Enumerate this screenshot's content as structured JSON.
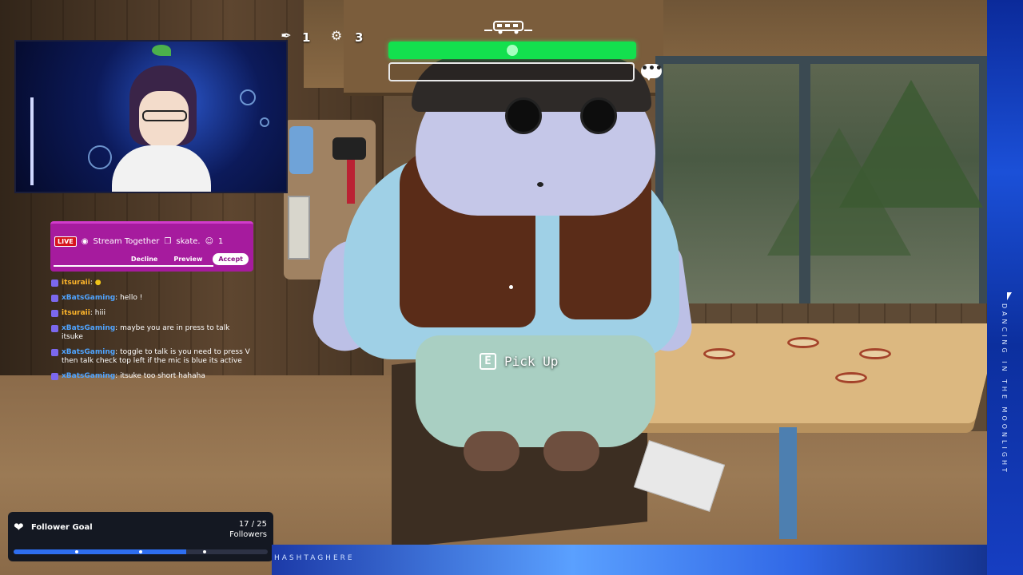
{
  "hud": {
    "item_count": "1",
    "tool_count": "3",
    "prompt_key": "E",
    "prompt_action": "Pick Up",
    "health_color": "#13e04e"
  },
  "webcam": {
    "description_icon": "vtuber-avatar"
  },
  "raid": {
    "live_label": "LIVE",
    "title": "Stream Together",
    "channel": "skate.",
    "viewers": "1",
    "decline_label": "Decline",
    "preview_label": "Preview",
    "accept_label": "Accept",
    "color": "#a61b9e"
  },
  "chat": [
    {
      "user": "itsuraii",
      "message": "",
      "emote": "duck-emote",
      "user_color": "#ffb62b"
    },
    {
      "user": "xBatsGaming",
      "message": "hello !",
      "user_color": "#4fa4ff"
    },
    {
      "user": "itsuraii",
      "message": "hiii",
      "user_color": "#ffb62b"
    },
    {
      "user": "xBatsGaming",
      "message": "maybe you are in press to talk itsuke",
      "user_color": "#4fa4ff"
    },
    {
      "user": "xBatsGaming",
      "message": "toggle to talk is you need to press V then talk check top left if the mic is blue its active",
      "user_color": "#4fa4ff"
    },
    {
      "user": "xBatsGaming",
      "message": "itsuke too short hahaha",
      "user_color": "#4fa4ff"
    }
  ],
  "follower_goal": {
    "title": "Follower Goal",
    "count": "17 / 25",
    "unit": "Followers",
    "progress_fraction": 0.68
  },
  "overlay": {
    "hashtag": "HASHTAGHERE",
    "vertical_text": "DANCING IN THE MOONLIGHT"
  }
}
